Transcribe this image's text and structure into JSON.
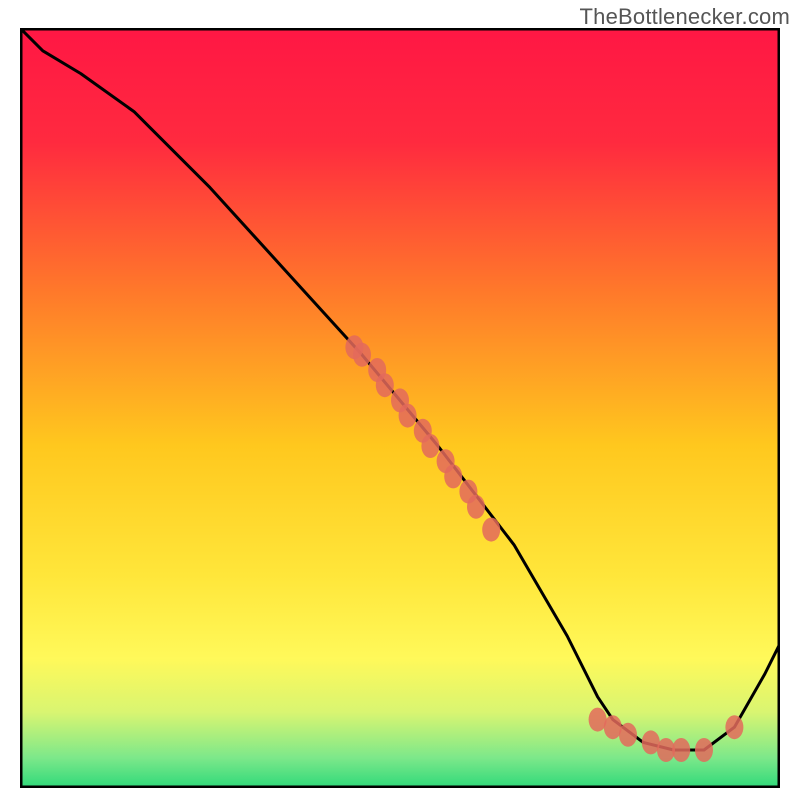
{
  "watermark": "TheBottlenecker.com",
  "chart_data": {
    "type": "line",
    "title": "",
    "xlabel": "",
    "ylabel": "",
    "xlim": [
      0,
      100
    ],
    "ylim": [
      0,
      100
    ],
    "grid": false,
    "background": "vertical-gradient red→yellow→green",
    "frame_color": "#000000",
    "series": [
      {
        "name": "curve",
        "type": "line",
        "color": "#000000",
        "x": [
          0,
          3,
          8,
          15,
          25,
          35,
          45,
          55,
          65,
          72,
          76,
          78,
          82,
          86,
          90,
          94,
          98,
          100
        ],
        "y": [
          100,
          97,
          94,
          89,
          79,
          68,
          57,
          45,
          32,
          20,
          12,
          9,
          6,
          5,
          5,
          8,
          15,
          19
        ]
      },
      {
        "name": "cluster-upper",
        "type": "scatter",
        "color": "#e36a5c",
        "marker": "circle",
        "x": [
          44,
          45,
          47,
          48,
          50,
          51,
          53,
          54,
          56,
          57,
          59,
          60,
          62
        ],
        "y": [
          58,
          57,
          55,
          53,
          51,
          49,
          47,
          45,
          43,
          41,
          39,
          37,
          34
        ]
      },
      {
        "name": "cluster-lower",
        "type": "scatter",
        "color": "#e36a5c",
        "marker": "circle",
        "x": [
          76,
          78,
          80,
          83,
          85,
          87,
          90,
          94
        ],
        "y": [
          9,
          8,
          7,
          6,
          5,
          5,
          5,
          8
        ]
      }
    ],
    "gradient_stops": [
      {
        "offset": 0.0,
        "color": "#ff1744"
      },
      {
        "offset": 0.15,
        "color": "#ff2a3f"
      },
      {
        "offset": 0.35,
        "color": "#ff7a2a"
      },
      {
        "offset": 0.55,
        "color": "#ffc81e"
      },
      {
        "offset": 0.72,
        "color": "#ffe63a"
      },
      {
        "offset": 0.83,
        "color": "#fff95a"
      },
      {
        "offset": 0.9,
        "color": "#d9f571"
      },
      {
        "offset": 0.96,
        "color": "#7de88a"
      },
      {
        "offset": 1.0,
        "color": "#2fd97a"
      }
    ]
  }
}
